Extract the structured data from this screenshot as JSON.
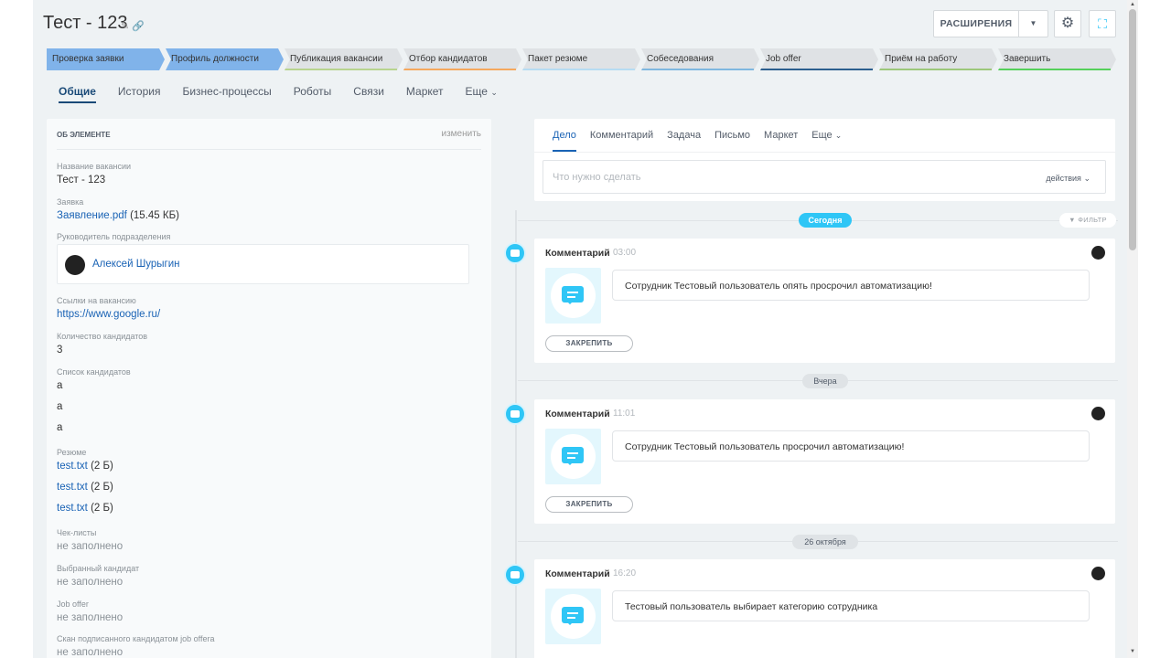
{
  "header": {
    "title": "Тест - 123",
    "extensions_label": "РАСШИРЕНИЯ"
  },
  "stages": [
    {
      "label": "Проверка заявки",
      "state": "active"
    },
    {
      "label": "Профиль должности",
      "state": "active"
    },
    {
      "label": "Публикация вакансии",
      "state": "inactive",
      "color": "#b8d48f"
    },
    {
      "label": "Отбор кандидатов",
      "state": "inactive",
      "color": "#f5a85e"
    },
    {
      "label": "Пакет резюме",
      "state": "inactive",
      "color": "#b6dcf2"
    },
    {
      "label": "Собеседования",
      "state": "inactive",
      "color": "#7fb7e0"
    },
    {
      "label": "Job offer",
      "state": "inactive",
      "color": "#2c5f8f"
    },
    {
      "label": "Приём на работу",
      "state": "inactive",
      "color": "#9cc77a"
    },
    {
      "label": "Завершить",
      "state": "inactive",
      "color": "#55d05a"
    }
  ],
  "tabs": [
    "Общие",
    "История",
    "Бизнес-процессы",
    "Роботы",
    "Связи",
    "Маркет",
    "Еще"
  ],
  "about": {
    "section_title": "ОБ ЭЛЕМЕНТЕ",
    "edit_label": "изменить",
    "fields": {
      "vacancy_name_label": "Название вакансии",
      "vacancy_name": "Тест - 123",
      "request_label": "Заявка",
      "request_file": "Заявление.pdf",
      "request_size": "(15.45 КБ)",
      "head_label": "Руководитель подразделения",
      "head_name": "Алексей Шурыгин",
      "links_label": "Ссылки на вакансию",
      "link": "https://www.google.ru/",
      "candidates_count_label": "Количество кандидатов",
      "candidates_count": "3",
      "candidates_list_label": "Список кандидатов",
      "candidates": [
        "a",
        "a",
        "a"
      ],
      "resume_label": "Резюме",
      "resume_files": [
        {
          "name": "test.txt",
          "size": "(2 Б)"
        },
        {
          "name": "test.txt",
          "size": "(2 Б)"
        },
        {
          "name": "test.txt",
          "size": "(2 Б)"
        }
      ],
      "checklists_label": "Чек-листы",
      "checklists": "не заполнено",
      "chosen_candidate_label": "Выбранный кандидат",
      "chosen_candidate": "не заполнено",
      "job_offer_label": "Job offer",
      "job_offer": "не заполнено",
      "scan_label": "Скан подписанного кандидатом job offerа",
      "scan": "не заполнено"
    }
  },
  "activity": {
    "tabs": [
      "Дело",
      "Комментарий",
      "Задача",
      "Письмо",
      "Маркет",
      "Еще"
    ],
    "todo_placeholder": "Что нужно сделать",
    "actions_label": "действия",
    "filter_label": "ФИЛЬТР",
    "groups": [
      {
        "date": "Сегодня",
        "entry": {
          "type": "Комментарий",
          "time": "03:00",
          "text": "Сотрудник Тестовый пользователь опять просрочил автоматизацию!",
          "pin": "ЗАКРЕПИТЬ"
        }
      },
      {
        "date": "Вчера",
        "entry": {
          "type": "Комментарий",
          "time": "11:01",
          "text": "Сотрудник Тестовый пользователь просрочил автоматизацию!",
          "pin": "ЗАКРЕПИТЬ"
        }
      },
      {
        "date": "26 октября",
        "entry": {
          "type": "Комментарий",
          "time": "16:20",
          "text": "Тестовый пользователь выбирает категорию сотрудника",
          "pin": "ЗАКРЕПИТЬ"
        }
      }
    ]
  }
}
